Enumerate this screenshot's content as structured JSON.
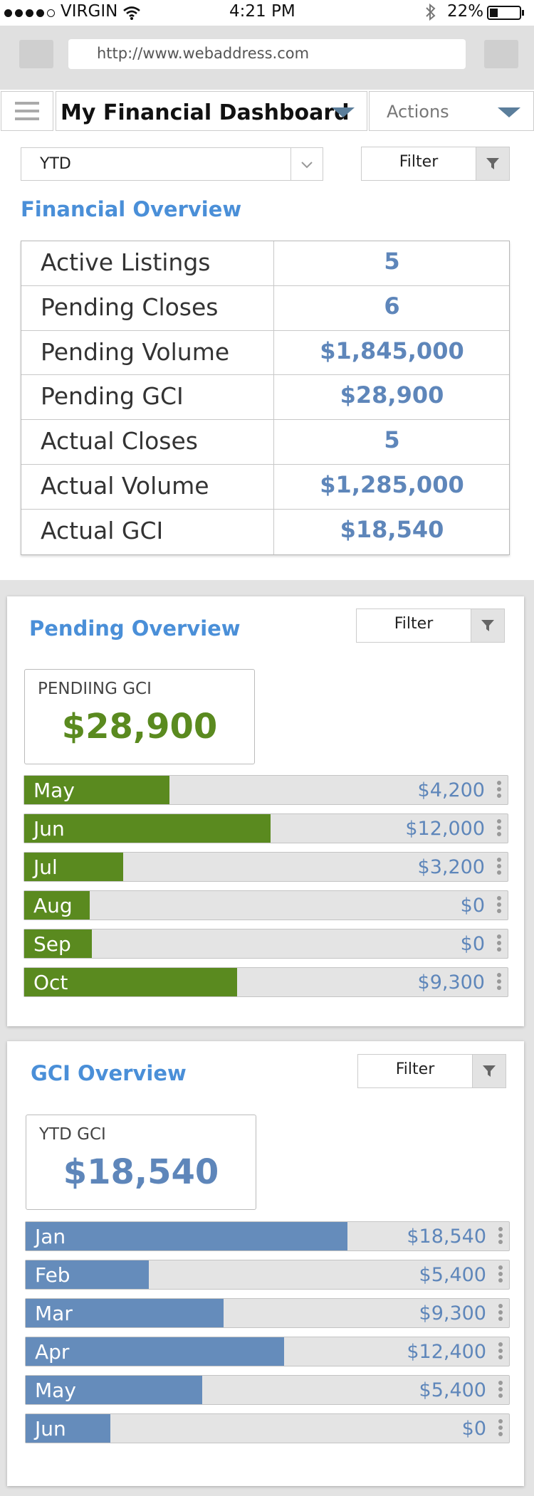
{
  "status_bar": {
    "carrier": "VIRGIN",
    "time": "4:21 PM",
    "battery": "22%"
  },
  "browser": {
    "url": "http://www.webaddress.com"
  },
  "app_header": {
    "title": "My Financial Dashboard",
    "actions_label": "Actions"
  },
  "overview": {
    "period": "YTD",
    "filter_label": "Filter",
    "title": "Financial Overview",
    "rows": [
      {
        "label": "Active Listings",
        "value": "5"
      },
      {
        "label": "Pending Closes",
        "value": "6"
      },
      {
        "label": "Pending Volume",
        "value": "$1,845,000"
      },
      {
        "label": "Pending GCI",
        "value": "$28,900"
      },
      {
        "label": "Actual Closes",
        "value": "5"
      },
      {
        "label": "Actual Volume",
        "value": "$1,285,000"
      },
      {
        "label": "Actual GCI",
        "value": "$18,540"
      }
    ]
  },
  "pending": {
    "title": "Pending Overview",
    "filter_label": "Filter",
    "kpi_label": "PENDIING GCI",
    "kpi_value": "$28,900",
    "bar_color": "#5a8a1f",
    "bars": [
      {
        "month": "May",
        "amount": "$4,200",
        "fill_pct": 30
      },
      {
        "month": "Jun",
        "amount": "$12,000",
        "fill_pct": 51
      },
      {
        "month": "Jul",
        "amount": "$3,200",
        "fill_pct": 20.5
      },
      {
        "month": "Aug",
        "amount": "$0",
        "fill_pct": 13.5
      },
      {
        "month": "Sep",
        "amount": "$0",
        "fill_pct": 14
      },
      {
        "month": "Oct",
        "amount": "$9,300",
        "fill_pct": 44
      }
    ]
  },
  "gci": {
    "title": "GCI Overview",
    "filter_label": "Filter",
    "kpi_label": "YTD GCI",
    "kpi_value": "$18,540",
    "bar_color": "#658cbb",
    "bars": [
      {
        "month": "Jan",
        "amount": "$18,540",
        "fill_pct": 66.5
      },
      {
        "month": "Feb",
        "amount": "$5,400",
        "fill_pct": 25.5
      },
      {
        "month": "Mar",
        "amount": "$9,300",
        "fill_pct": 41
      },
      {
        "month": "Apr",
        "amount": "$12,400",
        "fill_pct": 53.5
      },
      {
        "month": "May",
        "amount": "$5,400",
        "fill_pct": 36.5
      },
      {
        "month": "Jun",
        "amount": "$0",
        "fill_pct": 17.5
      }
    ]
  }
}
